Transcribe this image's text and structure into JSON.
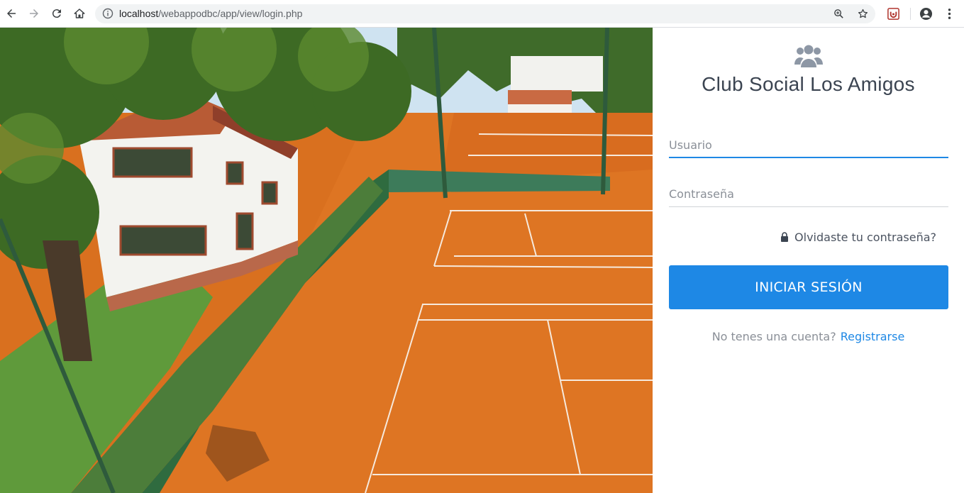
{
  "browser": {
    "url_host": "localhost",
    "url_path": "/webappodbc/app/view/login.php",
    "icons": [
      "back-icon",
      "forward-icon",
      "reload-icon",
      "home-icon",
      "info-icon",
      "zoom-icon",
      "star-icon",
      "extension-icon",
      "profile-icon",
      "menu-icon"
    ]
  },
  "login": {
    "title": "Club Social Los Amigos",
    "username_placeholder": "Usuario",
    "password_placeholder": "Contraseña",
    "forgot_label": "Olvidaste tu contraseña?",
    "submit_label": "INICIAR SESIÓN",
    "signup_prompt": "No tenes una cuenta?",
    "signup_link": "Registrarse"
  },
  "colors": {
    "accent": "#1e88e5",
    "title": "#3b4451",
    "muted": "#8a8f97",
    "clay": "#d9701f"
  }
}
